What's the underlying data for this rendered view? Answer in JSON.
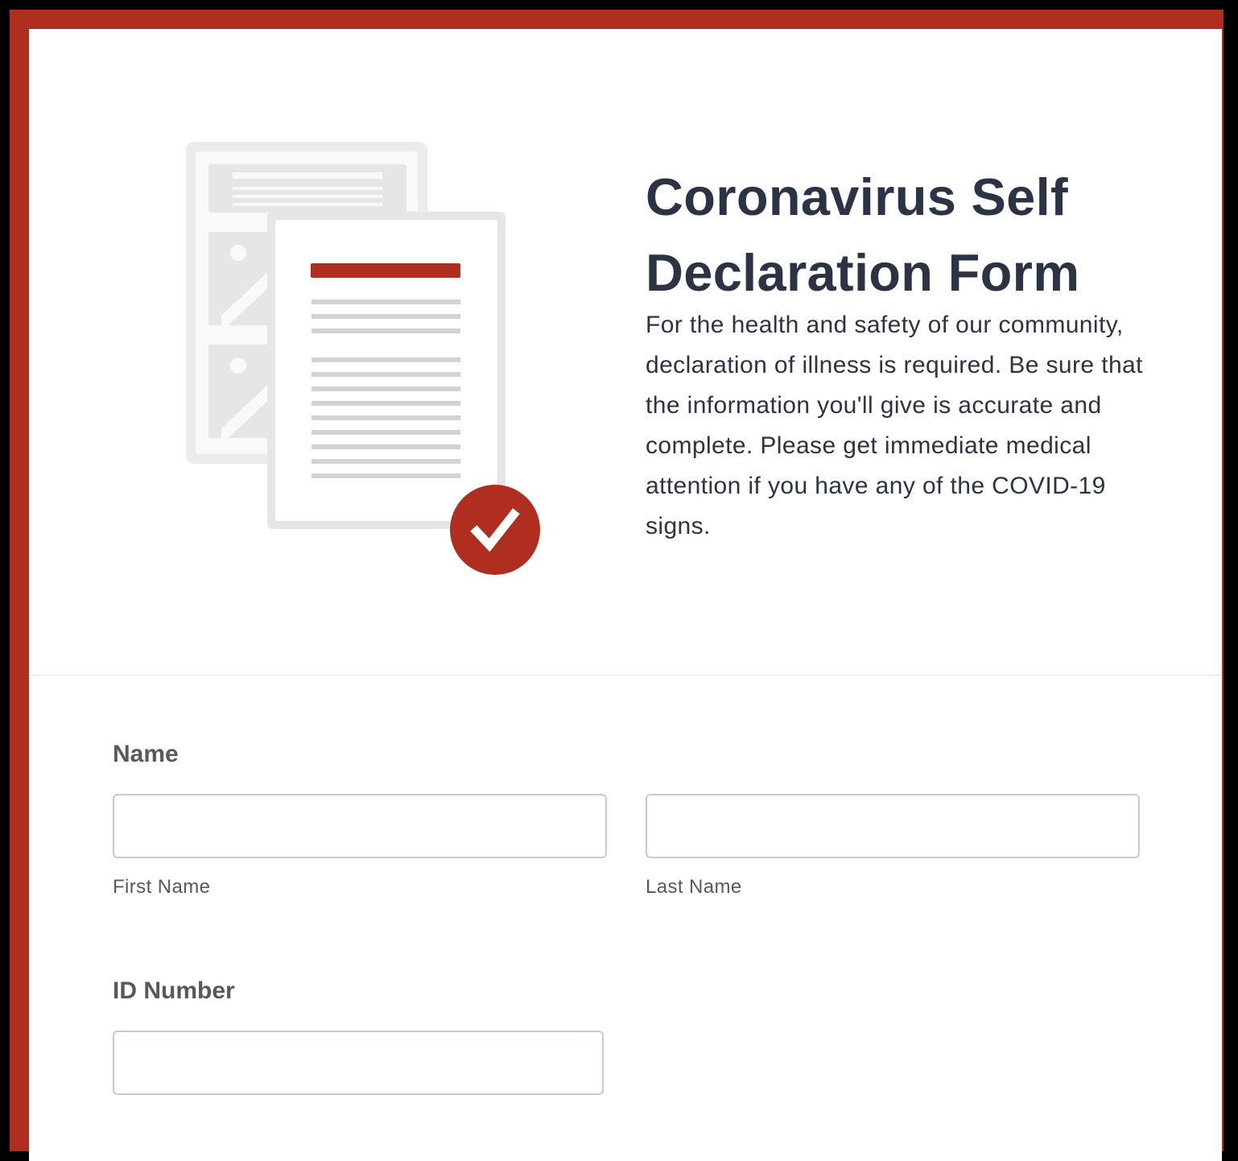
{
  "form": {
    "title": "Coronavirus Self Declaration Form",
    "description": "For the health and safety of our community, declaration of illness is required. Be sure that the information you'll give is accurate and complete. Please get immediate medical attention if you have any of the COVID-19 signs.",
    "illustration_icon": "documents-with-checkmark-icon",
    "accent_color": "#b02e1f",
    "text_color": "#2c3345",
    "label_color": "#57595b"
  },
  "fields": {
    "name": {
      "label": "Name",
      "first": {
        "value": "",
        "sublabel": "First Name"
      },
      "last": {
        "value": "",
        "sublabel": "Last Name"
      }
    },
    "id_number": {
      "label": "ID Number",
      "value": ""
    }
  }
}
